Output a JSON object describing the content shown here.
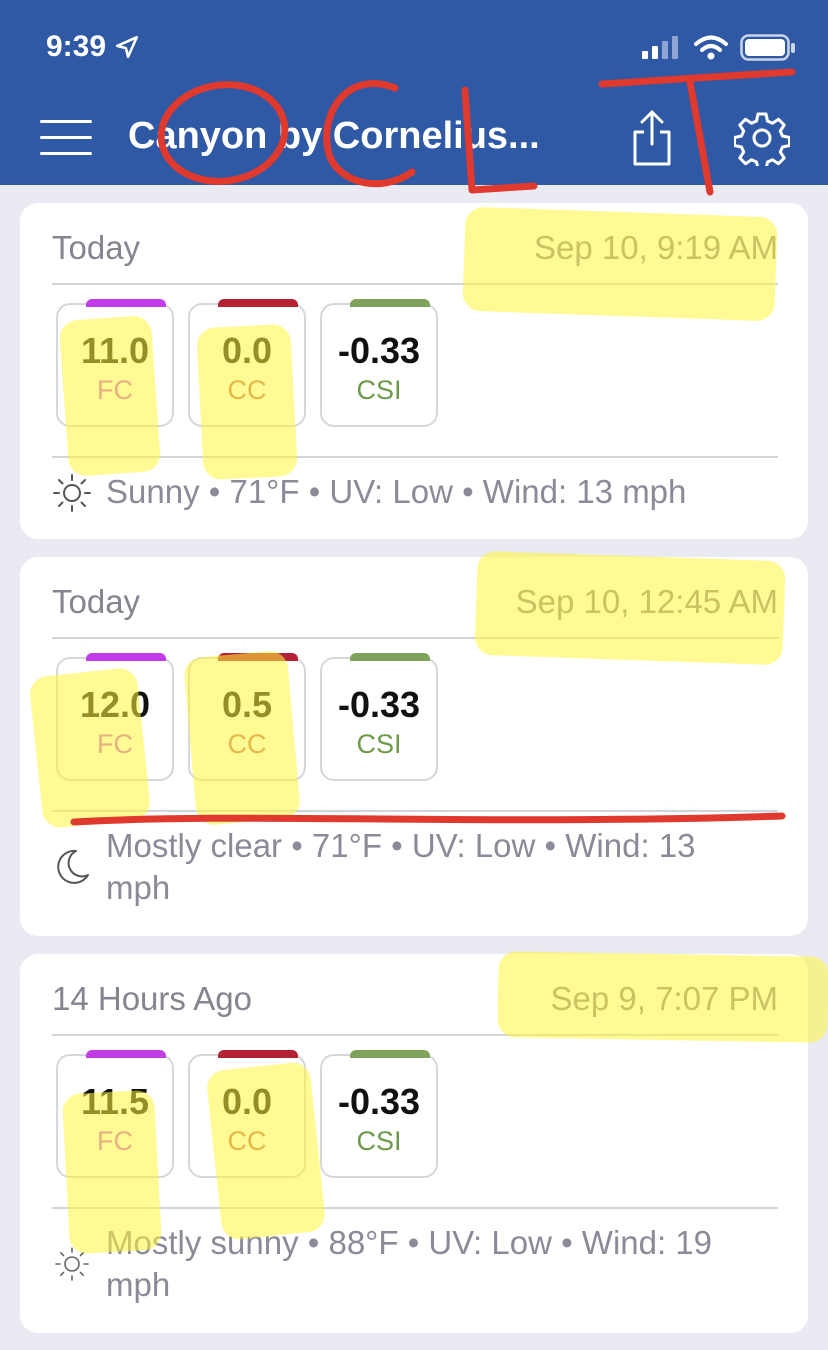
{
  "status_bar": {
    "time": "9:39"
  },
  "header": {
    "title": "Canyon by Cornelius..."
  },
  "annotation": {
    "handwritten": "OCLT"
  },
  "colors": {
    "header_bg": "#2f58a5",
    "fc_accent": "#c23de8",
    "cc_accent": "#b22234",
    "csi_accent": "#7fa35a",
    "fc_label": "#c95bd6",
    "cc_label": "#c46d5a",
    "csi_label": "#6e9a4a",
    "highlight": "#fff53c",
    "ink": "#e0392d"
  },
  "entries": [
    {
      "relative": "Today",
      "timestamp": "Sep 10, 9:19 AM",
      "metrics": [
        {
          "value": "11.0",
          "label": "FC"
        },
        {
          "value": "0.0",
          "label": "CC"
        },
        {
          "value": "-0.33",
          "label": "CSI"
        }
      ],
      "weather_icon": "sun-icon",
      "weather": "Sunny • 71°F • UV: Low • Wind: 13 mph"
    },
    {
      "relative": "Today",
      "timestamp": "Sep 10, 12:45 AM",
      "metrics": [
        {
          "value": "12.0",
          "label": "FC"
        },
        {
          "value": "0.5",
          "label": "CC"
        },
        {
          "value": "-0.33",
          "label": "CSI"
        }
      ],
      "weather_icon": "moon-icon",
      "weather": "Mostly clear • 71°F • UV: Low • Wind: 13 mph"
    },
    {
      "relative": "14 Hours Ago",
      "timestamp": "Sep 9, 7:07 PM",
      "metrics": [
        {
          "value": "11.5",
          "label": "FC"
        },
        {
          "value": "0.0",
          "label": "CC"
        },
        {
          "value": "-0.33",
          "label": "CSI"
        }
      ],
      "weather_icon": "sun-outline-icon",
      "weather": "Mostly sunny • 88°F • UV: Low • Wind: 19 mph"
    }
  ]
}
